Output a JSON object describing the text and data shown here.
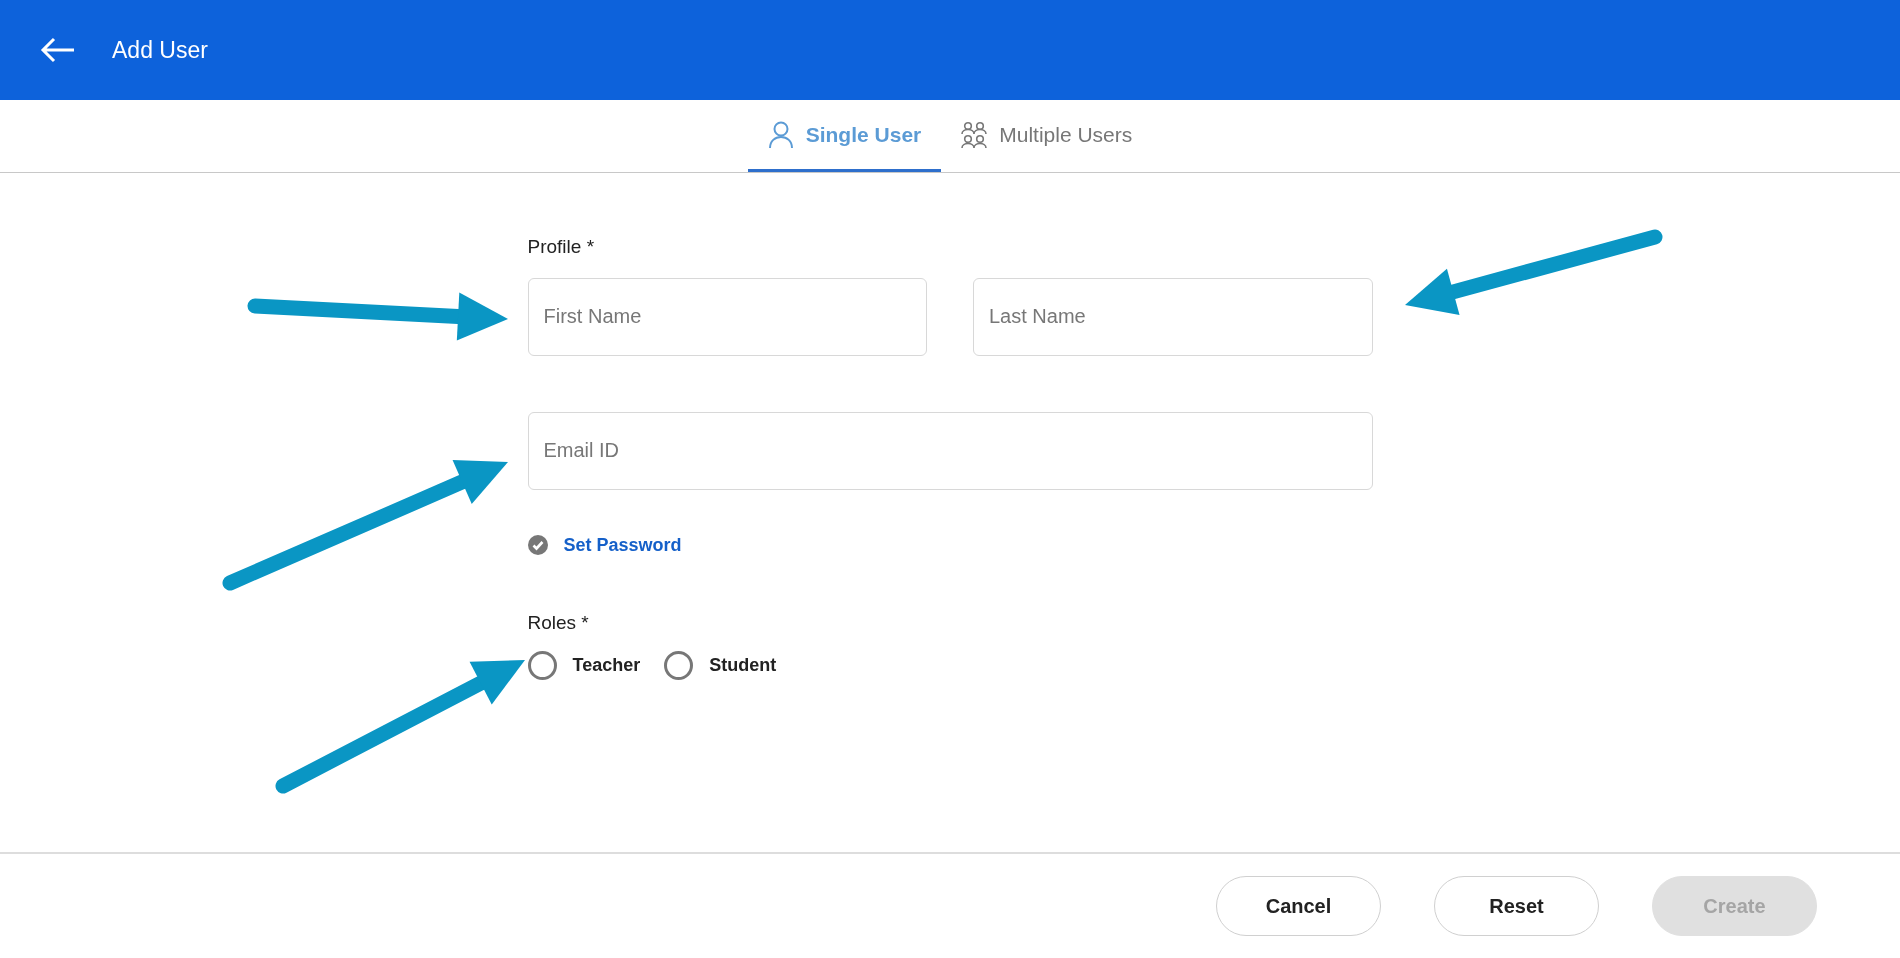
{
  "header": {
    "title": "Add User"
  },
  "tabs": [
    {
      "label": "Single User",
      "kind": "single",
      "selected": true
    },
    {
      "label": "Multiple Users",
      "kind": "multiple",
      "selected": false
    }
  ],
  "profile": {
    "label": "Profile *",
    "fields": [
      {
        "placeholder": "First Name"
      },
      {
        "placeholder": "Last Name"
      }
    ],
    "email": {
      "placeholder": "Email ID"
    }
  },
  "set_password": {
    "label": "Set Password",
    "checked": true
  },
  "roles": {
    "label": "Roles *",
    "options": [
      {
        "label": "Teacher",
        "selected": false
      },
      {
        "label": "Student",
        "selected": false
      }
    ]
  },
  "buttons": [
    {
      "label": "Cancel",
      "disabled": false
    },
    {
      "label": "Reset",
      "disabled": false
    },
    {
      "label": "Create",
      "disabled": true
    }
  ]
}
